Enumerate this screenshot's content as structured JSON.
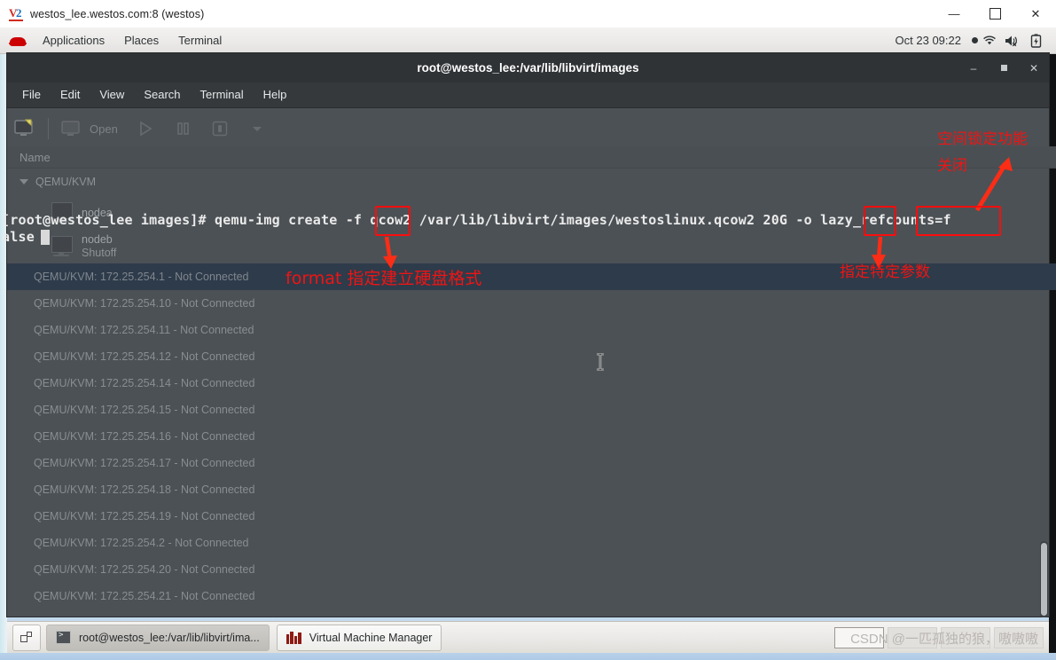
{
  "vnc_window": {
    "title": "westos_lee.westos.com:8 (westos)",
    "icon": "vnc-viewer-icon",
    "controls": {
      "minimize": "—",
      "maximize": "☐",
      "close": "✕"
    }
  },
  "gnome_panel": {
    "logo": "redhat-logo-icon",
    "menus": [
      "Applications",
      "Places",
      "Terminal"
    ],
    "clock": "Oct 23  09:22",
    "tray": [
      "wifi-icon",
      "volume-muted-icon",
      "battery-charging-icon"
    ]
  },
  "vmm": {
    "toolbar": {
      "new_vm": "new-vm-icon",
      "connection": "connection-icon",
      "open_label": "Open",
      "run": "run-icon",
      "pause": "pause-icon",
      "shutdown": "shutdown-icon",
      "dropdown": "chevron-down-icon"
    },
    "column_header": "Name",
    "tree_root": "QEMU/KVM",
    "vm_entries": [
      {
        "name": "nodea",
        "state": ""
      },
      {
        "name": "nodeb",
        "state": "Shutoff"
      }
    ],
    "connections": [
      {
        "label": "QEMU/KVM: 172.25.254.1 - Not Connected",
        "selected": true
      },
      {
        "label": "QEMU/KVM: 172.25.254.10 - Not Connected",
        "selected": false
      },
      {
        "label": "QEMU/KVM: 172.25.254.11 - Not Connected",
        "selected": false
      },
      {
        "label": "QEMU/KVM: 172.25.254.12 - Not Connected",
        "selected": false
      },
      {
        "label": "QEMU/KVM: 172.25.254.14 - Not Connected",
        "selected": false
      },
      {
        "label": "QEMU/KVM: 172.25.254.15 - Not Connected",
        "selected": false
      },
      {
        "label": "QEMU/KVM: 172.25.254.16 - Not Connected",
        "selected": false
      },
      {
        "label": "QEMU/KVM: 172.25.254.17 - Not Connected",
        "selected": false
      },
      {
        "label": "QEMU/KVM: 172.25.254.18 - Not Connected",
        "selected": false
      },
      {
        "label": "QEMU/KVM: 172.25.254.19 - Not Connected",
        "selected": false
      },
      {
        "label": "QEMU/KVM: 172.25.254.2 - Not Connected",
        "selected": false
      },
      {
        "label": "QEMU/KVM: 172.25.254.20 - Not Connected",
        "selected": false
      },
      {
        "label": "QEMU/KVM: 172.25.254.21 - Not Connected",
        "selected": false
      }
    ]
  },
  "terminal": {
    "title": "root@westos_lee:/var/lib/libvirt/images",
    "menus": [
      "File",
      "Edit",
      "View",
      "Search",
      "Terminal",
      "Help"
    ],
    "controls": {
      "minimize": "–",
      "maximize": "▫",
      "close": "✕"
    },
    "command_line_1": "[root@westos_lee images]# qemu-img create -f qcow2 /var/lib/libvirt/images/westoslinux.qcow2 20G -o lazy_refcounts=f",
    "command_line_2": "alse"
  },
  "annotations": [
    {
      "id": "anno-space-lock",
      "text": "空间锁定功能",
      "color": "#f01414"
    },
    {
      "id": "anno-space-lock-2",
      "text": "关闭",
      "color": "#f01414"
    },
    {
      "id": "anno-format",
      "text": "format 指定建立硬盘格式",
      "color": "#f01414"
    },
    {
      "id": "anno-param",
      "text": "指定特定参数",
      "color": "#f01414"
    }
  ],
  "taskbar": {
    "show_desktop": "show-desktop-icon",
    "tasks": [
      {
        "label": "root@westos_lee:/var/lib/libvirt/ima...",
        "icon": "terminal-icon",
        "active": true
      },
      {
        "label": "Virtual Machine Manager",
        "icon": "vmm-icon",
        "active": false
      }
    ],
    "watermark": "CSDN @一匹孤独的狼，嗷嗷嗷",
    "workspaces": 4,
    "active_workspace": 1
  }
}
